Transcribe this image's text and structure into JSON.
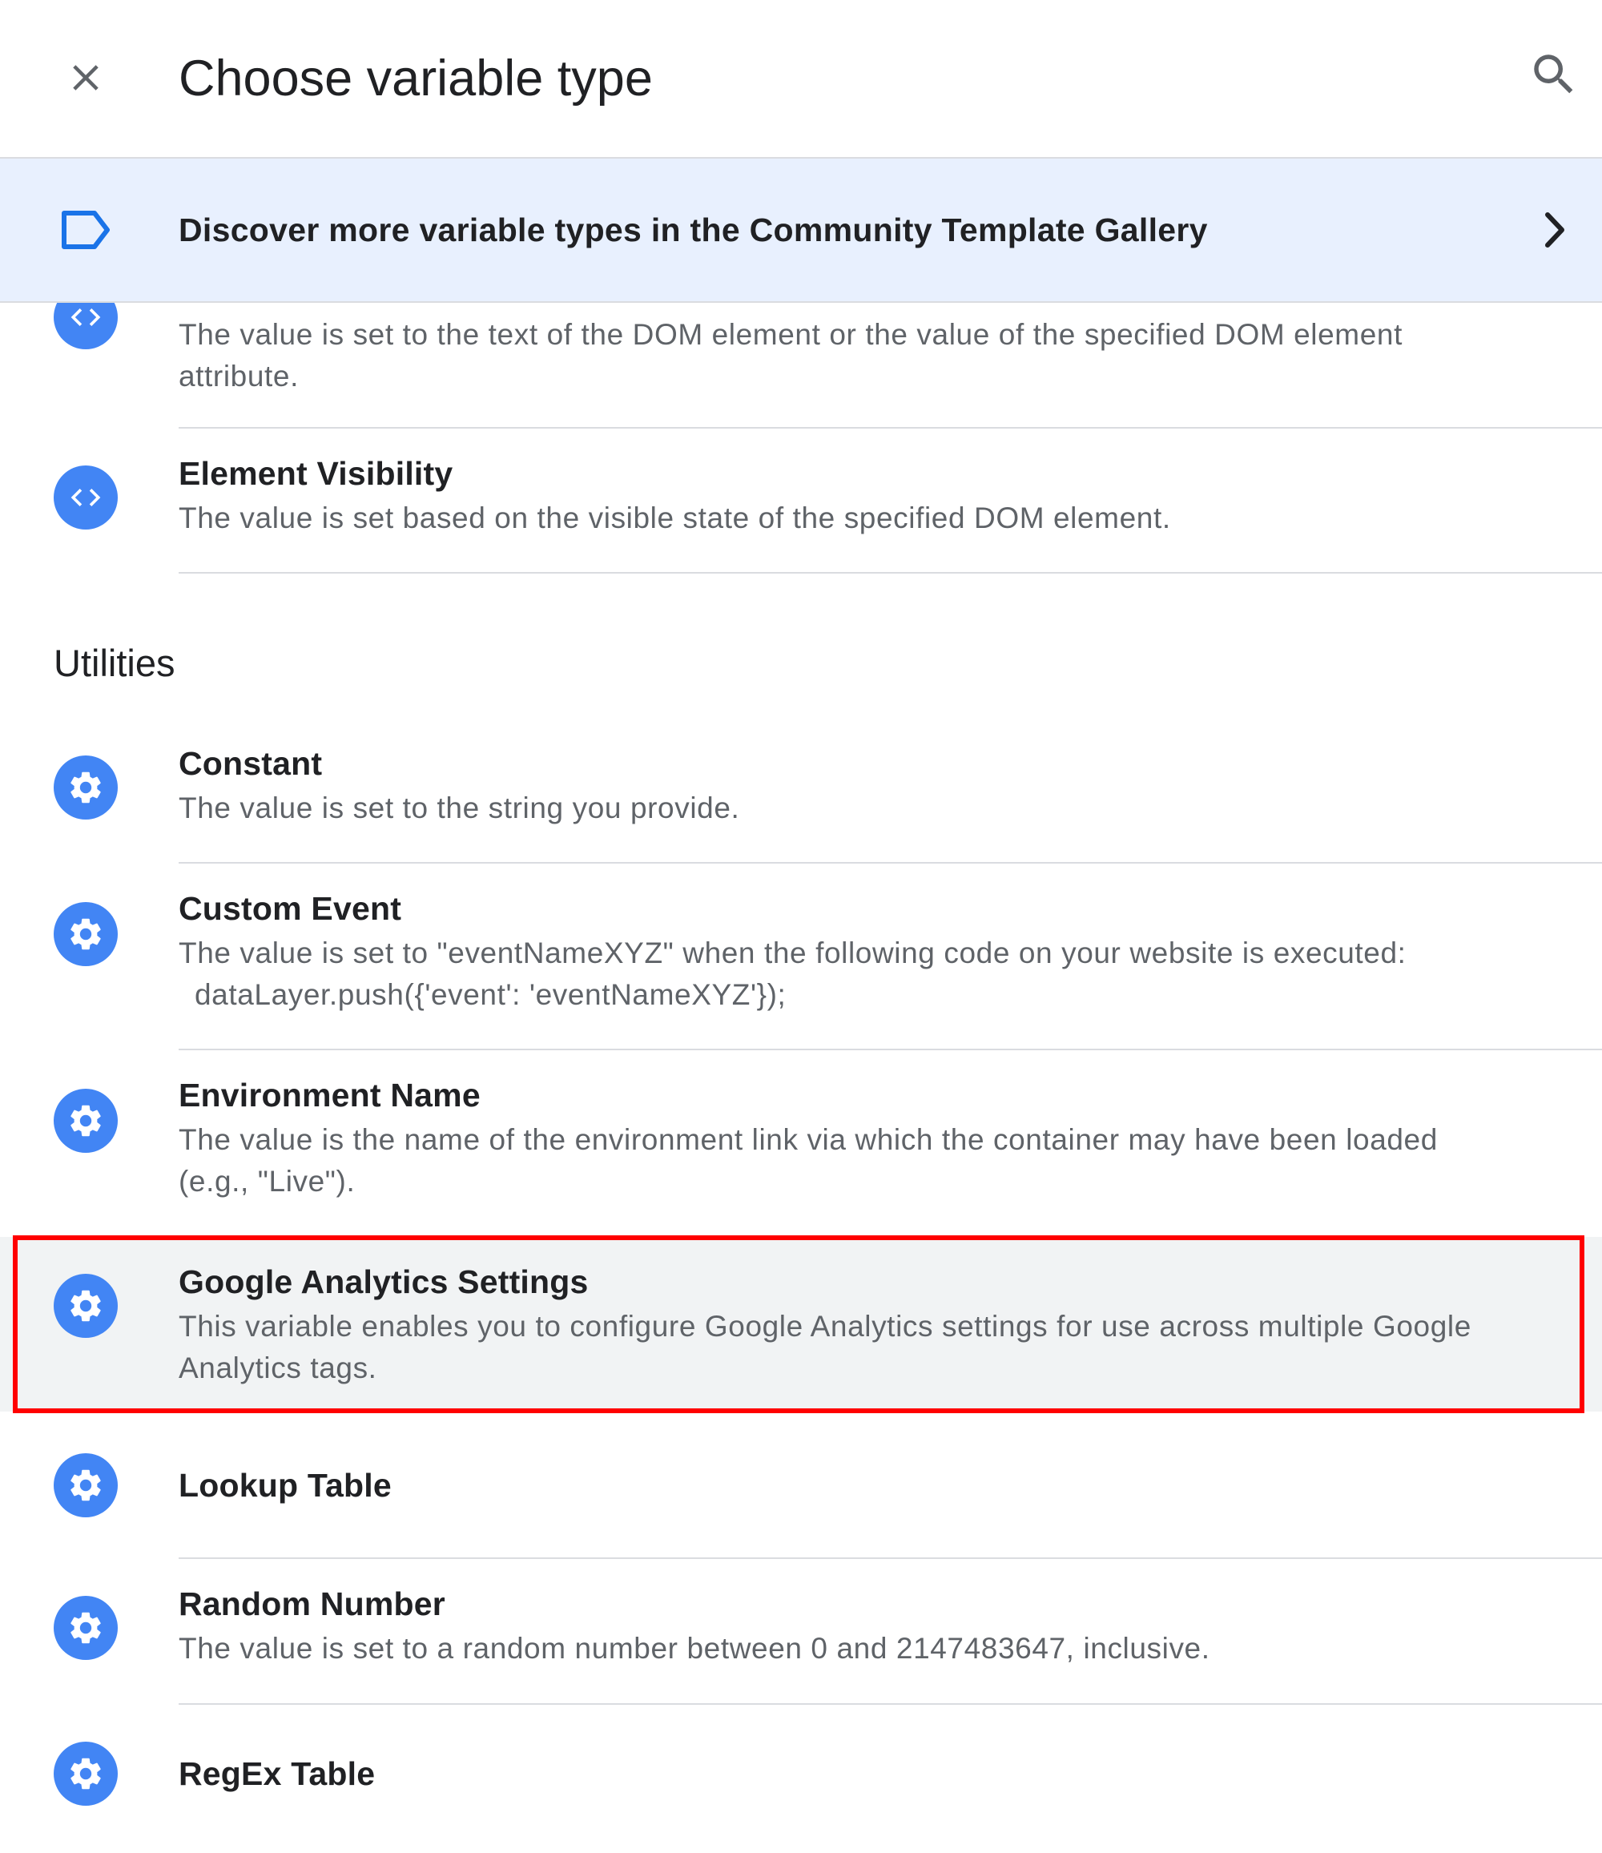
{
  "header": {
    "title": "Choose variable type"
  },
  "banner": {
    "text": "Discover more variable types in the Community Template Gallery"
  },
  "items_top": [
    {
      "name": "",
      "desc": "The value is set to the text of the DOM element or the value of the specified DOM element attribute.",
      "icon": "code-brackets-icon"
    },
    {
      "name": "Element Visibility",
      "desc": "The value is set based on the visible state of the specified DOM element.",
      "icon": "code-brackets-icon"
    }
  ],
  "section": {
    "title": "Utilities"
  },
  "utilities": [
    {
      "name": "Constant",
      "desc": "The value is set to the string you provide.",
      "icon": "gear-icon"
    },
    {
      "name": "Custom Event",
      "desc": "The value is set to \"eventNameXYZ\" when the following code on your website is executed:",
      "code": "dataLayer.push({'event': 'eventNameXYZ'});",
      "icon": "gear-icon"
    },
    {
      "name": "Environment Name",
      "desc": "The value is the name of the environment link via which the container may have been loaded (e.g., \"Live\").",
      "icon": "gear-icon"
    },
    {
      "name": "Google Analytics Settings",
      "desc": "This variable enables you to configure Google Analytics settings for use across multiple Google Analytics tags.",
      "icon": "gear-icon",
      "highlighted": true
    },
    {
      "name": "Lookup Table",
      "desc": "",
      "icon": "gear-icon"
    },
    {
      "name": "Random Number",
      "desc": "The value is set to a random number between 0 and 2147483647, inclusive.",
      "icon": "gear-icon"
    },
    {
      "name": "RegEx Table",
      "desc": "",
      "icon": "gear-icon"
    }
  ],
  "colors": {
    "accent": "#4285f4",
    "banner_bg": "#e8f0fe",
    "highlight_border": "#ff0000",
    "highlight_bg": "#f1f3f4"
  }
}
